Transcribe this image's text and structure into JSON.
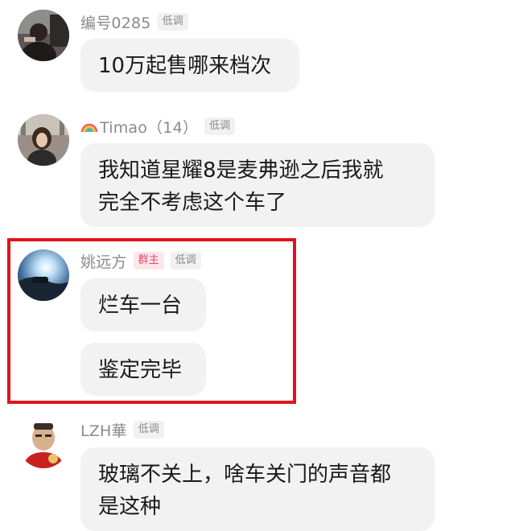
{
  "messages": [
    {
      "sender": "编号0285",
      "level": "低调",
      "bubbles": [
        "10万起售哪来档次"
      ]
    },
    {
      "sender_icon": "rainbow-icon",
      "sender": "Timao（14）",
      "level": "低调",
      "bubbles": [
        "我知道星耀8是麦弗逊之后我就\n完全不考虑这个车了"
      ]
    },
    {
      "sender": "姚远方",
      "role": "群主",
      "level": "低调",
      "bubbles": [
        "烂车一台",
        "鉴定完毕"
      ],
      "highlighted": true,
      "highlight_color": "#e0141e"
    },
    {
      "sender": "LZH華",
      "level": "低调",
      "bubbles": [
        "玻璃不关上，啥车关门的声音都\n是这种"
      ]
    }
  ]
}
